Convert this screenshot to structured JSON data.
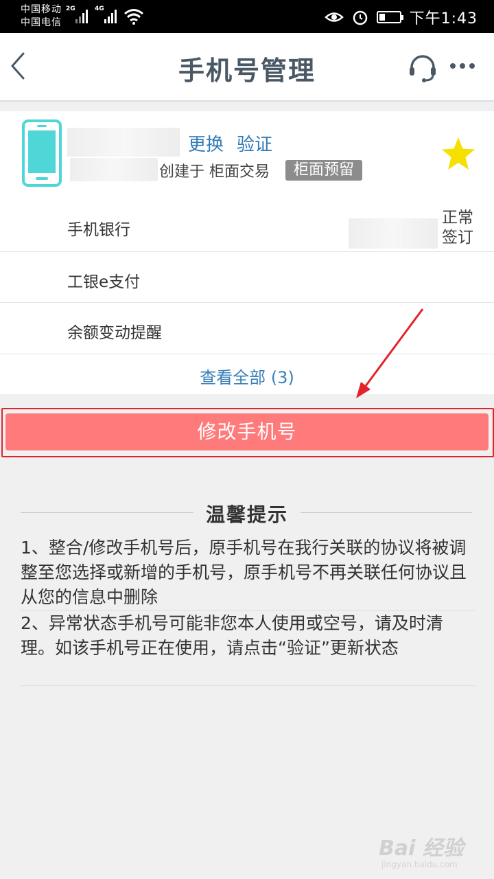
{
  "status_bar": {
    "carrier_1": "中国移动",
    "carrier_2": "中国电信",
    "network_1": "2G",
    "network_2": "4G",
    "time": "下午1:43",
    "icons": [
      "signal-icon",
      "wifi-icon",
      "eye-icon",
      "alarm-icon",
      "battery-icon"
    ]
  },
  "nav": {
    "title": "手机号管理",
    "icons": [
      "back-chevron-icon",
      "headset-icon",
      "more-dots-icon"
    ]
  },
  "phone_card": {
    "change_label": "更换",
    "verify_label": "验证",
    "created_text": "创建于 柜面交易",
    "tag": "柜面预留",
    "star_color": "#f5e000",
    "icon_color": "#4fd6d6"
  },
  "services": [
    {
      "label": "手机银行",
      "status": "正常签订"
    },
    {
      "label": "工银e支付"
    },
    {
      "label": "余额变动提醒"
    }
  ],
  "view_all": "查看全部 (3)",
  "modify_button": "修改手机号",
  "tips": {
    "title": "温馨提示",
    "items": [
      "1、整合/修改手机号后，原手机号在我行关联的协议将被调整至您选择或新增的手机号，原手机号不再关联任何协议且从您的信息中删除",
      "2、异常状态手机号可能非您本人使用或空号，请及时清理。如该手机号正在使用，请点击“验证”更新状态"
    ]
  },
  "watermark": {
    "brand": "Bai 经验",
    "url": "jingyan.baidu.com"
  },
  "colors": {
    "accent_link": "#2f7ab8",
    "button_bg": "#ff7a7a",
    "highlight_border": "#e2242a",
    "title_text": "#4a5866"
  }
}
